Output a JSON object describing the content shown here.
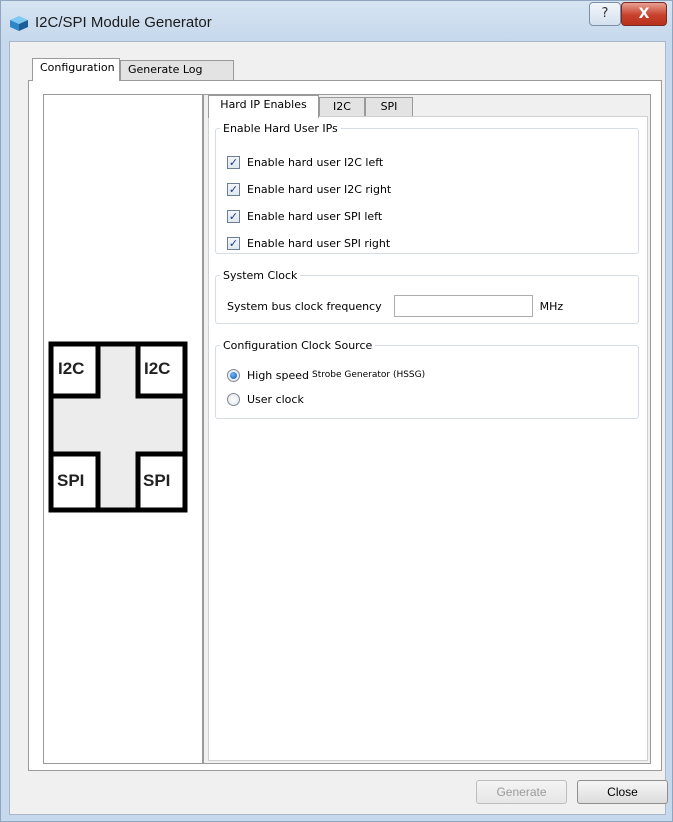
{
  "window": {
    "title": "I2C/SPI Module Generator",
    "help_glyph": "?",
    "close_glyph": "X"
  },
  "outer_tabs": [
    {
      "label": "Configuration",
      "active": true
    },
    {
      "label": "Generate Log",
      "active": false
    }
  ],
  "diagram": {
    "top_left": "I2C",
    "top_right": "I2C",
    "bottom_left": "SPI",
    "bottom_right": "SPI"
  },
  "inner_tabs": [
    {
      "label": "Hard IP Enables",
      "active": true
    },
    {
      "label": "I2C",
      "active": false
    },
    {
      "label": "SPI",
      "active": false
    }
  ],
  "hard_ips": {
    "legend": "Enable Hard User IPs",
    "options": [
      {
        "label": "Enable hard user I2C left",
        "checked": true
      },
      {
        "label": "Enable hard user I2C right",
        "checked": true
      },
      {
        "label": "Enable hard user SPI left",
        "checked": true
      },
      {
        "label": "Enable hard user SPI right",
        "checked": true
      }
    ]
  },
  "system_clock": {
    "legend": "System Clock",
    "label": "System bus clock frequency",
    "value": "",
    "unit": "MHz"
  },
  "clock_source": {
    "legend": "Configuration Clock Source",
    "options": [
      {
        "label_main": "High speed ",
        "label_small": "Strobe Generator (HSSG)",
        "selected": true
      },
      {
        "label_main": "User clock",
        "label_small": "",
        "selected": false
      }
    ]
  },
  "footer": {
    "generate_label": "Generate",
    "generate_enabled": false,
    "close_label": "Close"
  },
  "icons": {
    "app": "cube-icon",
    "check": "✓"
  }
}
